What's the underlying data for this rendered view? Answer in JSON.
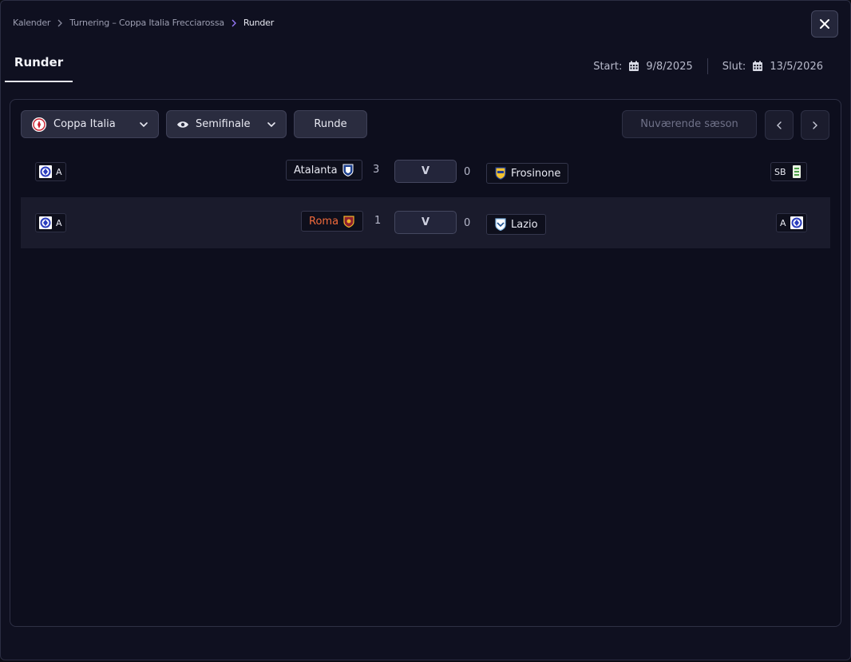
{
  "breadcrumb": {
    "items": [
      "Kalender",
      "Turnering – Coppa Italia Frecciarossa",
      "Runder"
    ]
  },
  "tabs": {
    "active": "Runder"
  },
  "dates": {
    "start_label": "Start:",
    "start_value": "9/8/2025",
    "end_label": "Slut:",
    "end_value": "13/5/2026"
  },
  "filters": {
    "tournament": "Coppa Italia",
    "stage": "Semifinale",
    "round_button": "Runde",
    "season_button": "Nuværende sæson"
  },
  "matches": [
    {
      "home_league": "A",
      "home_team": "Atalanta",
      "home_score": "3",
      "vs": "V",
      "away_score": "0",
      "away_team": "Frosinone",
      "away_league": "SB"
    },
    {
      "home_league": "A",
      "home_team": "Roma",
      "home_score": "1",
      "vs": "V",
      "away_score": "0",
      "away_team": "Lazio",
      "away_league": "A"
    }
  ],
  "colors": {
    "background": "#0f1020",
    "panel": "#0d0e1d",
    "highlight_team": "#f06a3b",
    "accent_chevron": "#9b7bff"
  },
  "icons": {
    "close": "close-icon",
    "calendar": "calendar-icon",
    "chevron_down": "chevron-down-icon",
    "eye": "eye-icon",
    "nav_prev": "chevron-left-icon",
    "nav_next": "chevron-right-icon"
  }
}
